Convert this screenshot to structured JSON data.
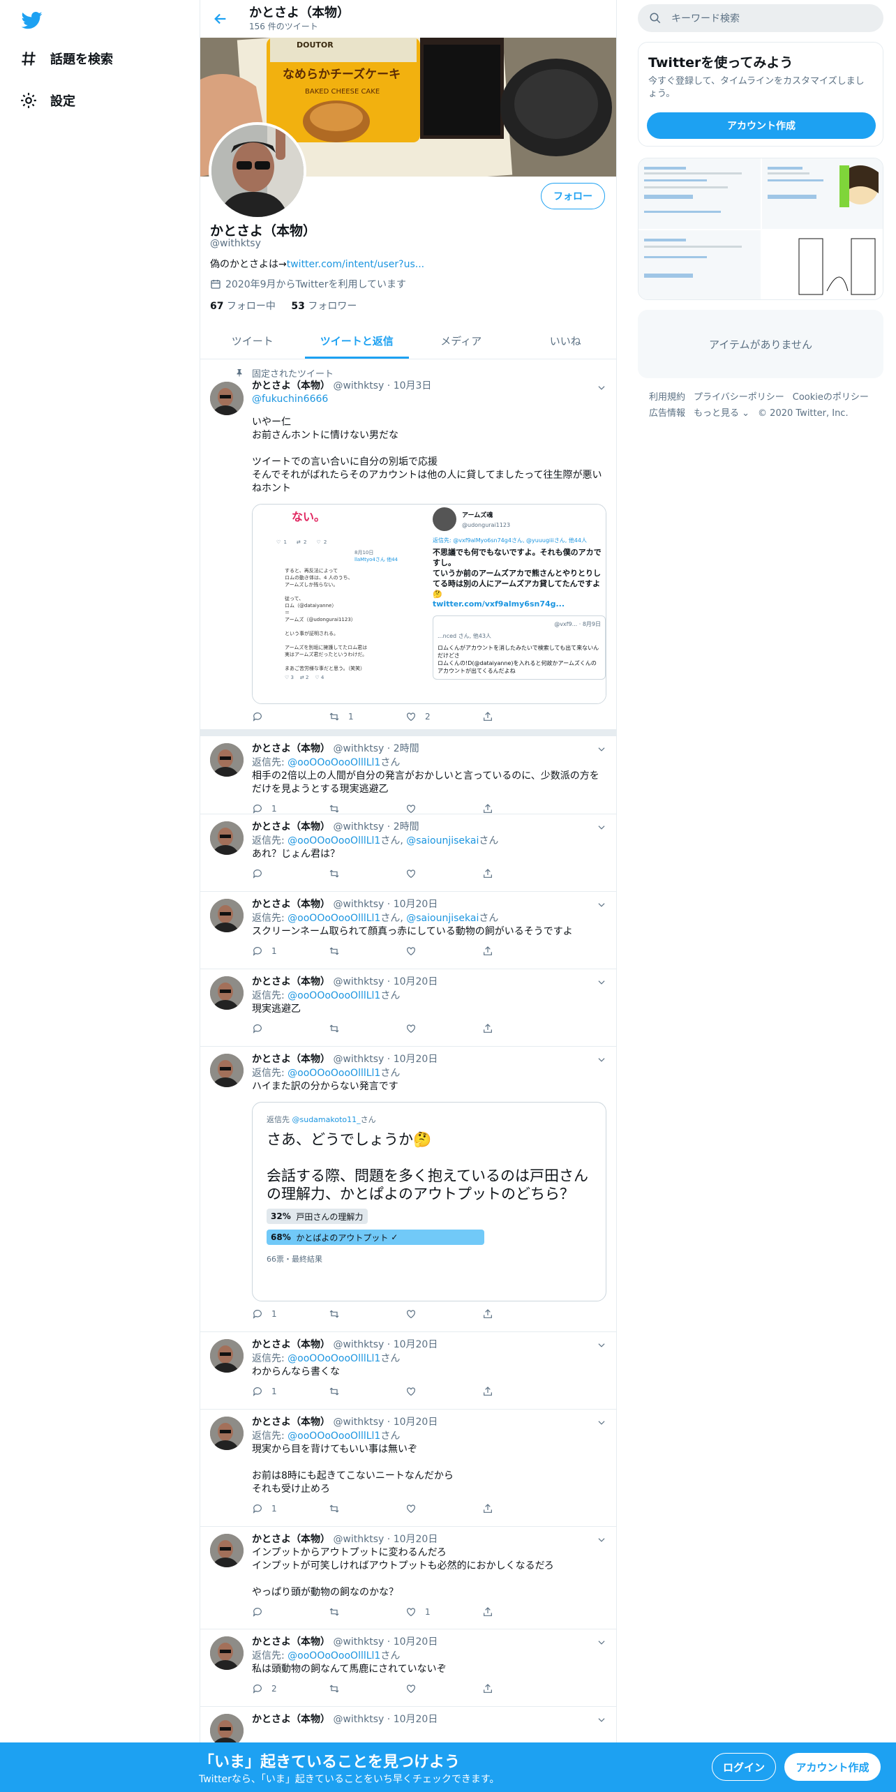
{
  "nav": {
    "explore": "話題を検索",
    "settings": "設定"
  },
  "header": {
    "title": "かとさよ（本物）",
    "subtitle": "156 件のツイート"
  },
  "banner": {
    "package_text": "なめらかチーズケーキ",
    "package_sub": "BAKED CHEESE CAKE",
    "brand": "DOUTOR"
  },
  "profile": {
    "name": "かとさよ（本物）",
    "handle": "@withktsy",
    "bio_prefix": "偽のかとさよは→",
    "bio_link": "twitter.com/intent/user?us...",
    "joined": "2020年9月からTwitterを利用しています",
    "following_count": "67",
    "following_label": " フォロー中",
    "followers_count": "53",
    "followers_label": " フォロワー",
    "follow_button": "フォロー"
  },
  "tabs": [
    "ツイート",
    "ツイートと返信",
    "メディア",
    "いいね"
  ],
  "pinned_label": "固定されたツイート",
  "tweets": [
    {
      "name": "かとさよ（本物）",
      "handle": "@withktsy",
      "time": "10月3日",
      "mention": "@fukuchin6666",
      "text": "いやー仁\nお前さんホントに情けない男だな\n\nツイートでの言い合いに自分の別垢で応援\nそんでそれがばれたらそのアカウントは他の人に貸してましたって往生際が悪いねホント",
      "reply_count": "",
      "rt_count": "1",
      "like_count": "2"
    },
    {
      "name": "かとさよ（本物）",
      "handle": "@withktsy",
      "time": "2時間",
      "reply_prefix": "返信先: ",
      "reply_to": "@ooOOoOooOlllLl1",
      "reply_suffix": "さん",
      "text": "相手の2倍以上の人間が自分の発言がおかしいと言っているのに、少数派の方をだけを見ようとする現実逃避乙",
      "reply_count": "1",
      "rt_count": "",
      "like_count": ""
    },
    {
      "name": "かとさよ（本物）",
      "handle": "@withktsy",
      "time": "2時間",
      "reply_prefix": "返信先: ",
      "reply_to": "@ooOOoOooOlllLl1",
      "reply_mid": "さん, ",
      "reply_to2": "@saiounjisekai",
      "reply_suffix": "さん",
      "text": "あれ？じょん君は？",
      "reply_count": "",
      "rt_count": "",
      "like_count": ""
    },
    {
      "name": "かとさよ（本物）",
      "handle": "@withktsy",
      "time": "10月20日",
      "reply_prefix": "返信先: ",
      "reply_to": "@ooOOoOooOlllLl1",
      "reply_mid": "さん, ",
      "reply_to2": "@saiounjisekai",
      "reply_suffix": "さん",
      "text": "スクリーンネーム取られて顔真っ赤にしている動物の飼がいるそうですよ",
      "reply_count": "1",
      "rt_count": "",
      "like_count": ""
    },
    {
      "name": "かとさよ（本物）",
      "handle": "@withktsy",
      "time": "10月20日",
      "reply_prefix": "返信先: ",
      "reply_to": "@ooOOoOooOlllLl1",
      "reply_suffix": "さん",
      "text": "現実逃避乙",
      "reply_count": "",
      "rt_count": "",
      "like_count": ""
    },
    {
      "name": "かとさよ（本物）",
      "handle": "@withktsy",
      "time": "10月20日",
      "reply_prefix": "返信先: ",
      "reply_to": "@ooOOoOooOlllLl1",
      "reply_suffix": "さん",
      "text": "ハイまた訳の分からない発言です",
      "reply_count": "1",
      "rt_count": "",
      "like_count": ""
    },
    {
      "name": "かとさよ（本物）",
      "handle": "@withktsy",
      "time": "10月20日",
      "reply_prefix": "返信先: ",
      "reply_to": "@ooOOoOooOlllLl1",
      "reply_suffix": "さん",
      "text": "わからんなら書くな",
      "reply_count": "1",
      "rt_count": "",
      "like_count": ""
    },
    {
      "name": "かとさよ（本物）",
      "handle": "@withktsy",
      "time": "10月20日",
      "reply_prefix": "返信先: ",
      "reply_to": "@ooOOoOooOlllLl1",
      "reply_suffix": "さん",
      "text": "現実から目を背けてもいい事は無いぞ\n\nお前は8時にも起きてこないニートなんだから\nそれも受け止めろ",
      "reply_count": "1",
      "rt_count": "",
      "like_count": ""
    },
    {
      "name": "かとさよ（本物）",
      "handle": "@withktsy",
      "time": "10月20日",
      "text": "インプットからアウトプットに変わるんだろ\nインプットが可笑しければアウトプットも必然的におかしくなるだろ\n\nやっぱり頭が動物の飼なのかな？",
      "reply_count": "",
      "rt_count": "",
      "like_count": "1"
    },
    {
      "name": "かとさよ（本物）",
      "handle": "@withktsy",
      "time": "10月20日",
      "reply_prefix": "返信先: ",
      "reply_to": "@ooOOoOooOlllLl1",
      "reply_suffix": "さん",
      "text": "私は頭動物の飼なんて馬鹿にされていないぞ",
      "reply_count": "2",
      "rt_count": "",
      "like_count": ""
    },
    {
      "name": "かとさよ（本物）",
      "handle": "@withktsy",
      "time": "10月20日"
    }
  ],
  "media1": {
    "left_top": "ない。",
    "left_date": "8月10日",
    "left_reply": "llaMtyo4さん 他44",
    "left_body": "すると、再反法によって\nロムの動き体は、4 人のうち、\nアームズしか残らない。\n\n従って、\nロム（@dataiyanne）\n＝\nアームズ（@udongurai1123）\n\nという事が証明される。\n\nアームズを別垢に擁護してたロム君は\n実はアームズ君だったというわけだ。\n\nまあご苦労様な事だと思う。（笑笑）",
    "left_counts": [
      "1",
      "2",
      "2"
    ],
    "left_counts2": [
      "3",
      "2",
      "4"
    ],
    "right_name": "アームズ魂",
    "right_handle": "@udongurai1123",
    "right_reply": "返信先: @vxf9alMyo6sn74g4さん, @yuuugiiiさん, 他44人",
    "right_body": "不思議でも何でもないですよ。それも僕のアカですし。\nていうか前のアームズアカで熊さんとやりとりしてる時は別の人にアームズアカ貸してたんですよ🤔",
    "right_link": "twitter.com/vxf9almy6sn74g...",
    "right_inner_head": "@vxf9... · 8月9日",
    "right_inner_reply": "...nced さん, 他43人",
    "right_inner_body": "ロムくんがアカウントを消したみたいで検索しても出て来ないんだけどさ\nロムくんの!D(@dataiyanne)を入れると何故かアームズくんのアカウントが出てくるんだよね"
  },
  "poll": {
    "reply_prefix": "返信先 ",
    "reply_to": "@sudamakoto11_",
    "reply_suffix": "さん",
    "question": "さあ、どうでしょうか🤔\n\n会話する際、問題を多く抱えているのは戸田さんの理解力、かとぱよのアウトプットのどちら？",
    "options": [
      {
        "pct": "32%",
        "label": "戸田さんの理解力",
        "value": 0.32
      },
      {
        "pct": "68%",
        "label": "かとぱよのアウトプット",
        "value": 0.68
      }
    ],
    "meta": "66票・最終結果",
    "winner_color": "#71c9f8",
    "loser_color": "#e1e8ed"
  },
  "right": {
    "search_placeholder": "キーワード検索",
    "promo_title": "Twitterを使ってみよう",
    "promo_text": "今すぐ登録して、タイムラインをカスタマイズしましょう。",
    "promo_button": "アカウント作成",
    "no_items": "アイテムがありません",
    "footer": [
      "利用規約",
      "プライバシーポリシー",
      "Cookieのポリシー",
      "広告情報",
      "もっと見る ⌄",
      "© 2020 Twitter, Inc."
    ]
  },
  "bottom": {
    "headline": "「いま」起きていることを見つけよう",
    "sub": "Twitterなら、「いま」起きていることをいち早くチェックできます。",
    "login": "ログイン",
    "signup": "アカウント作成"
  },
  "colors": {
    "accent": "#1da1f2",
    "link": "#1b95e0"
  },
  "icons": [
    "twitter-logo-icon",
    "hashtag-icon",
    "gear-icon",
    "back-arrow-icon",
    "calendar-icon",
    "pin-icon",
    "reply-icon",
    "retweet-icon",
    "like-icon",
    "share-icon",
    "chevron-down-icon",
    "search-icon"
  ]
}
